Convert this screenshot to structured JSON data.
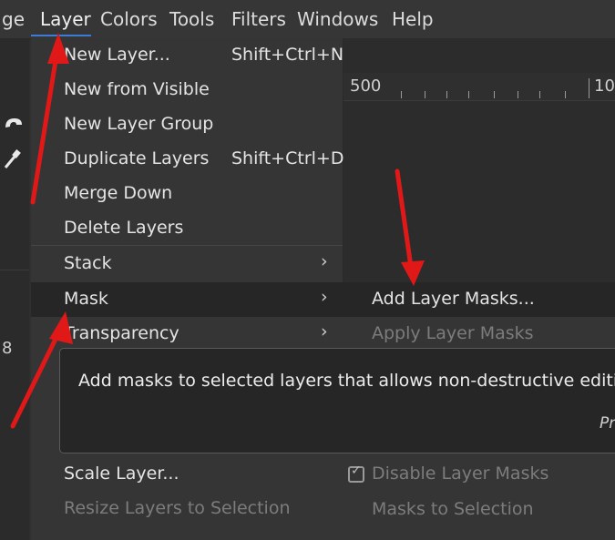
{
  "menubar": {
    "items": [
      "ge",
      "Layer",
      "Colors",
      "Tools",
      "Filters",
      "Windows",
      "Help"
    ]
  },
  "canvas": {
    "ruler_left": "500",
    "ruler_right": "10"
  },
  "left_strip": {
    "number": "8"
  },
  "layer_menu": {
    "items": [
      {
        "label": "New Layer...",
        "shortcut": "Shift+Ctrl+N"
      },
      {
        "label": "New from Visible",
        "shortcut": ""
      },
      {
        "label": "New Layer Group",
        "shortcut": ""
      },
      {
        "label": "Duplicate Layers",
        "shortcut": "Shift+Ctrl+D"
      },
      {
        "label": "Merge Down",
        "shortcut": ""
      },
      {
        "label": "Delete Layers",
        "shortcut": ""
      },
      {
        "label": "Stack",
        "shortcut": "",
        "submenu_arrow": "›"
      },
      {
        "label": "Mask",
        "shortcut": "",
        "submenu_arrow": "›"
      },
      {
        "label": "Transparency",
        "shortcut": "",
        "submenu_arrow": "›"
      },
      {
        "label": "Scale Layer...",
        "shortcut": ""
      },
      {
        "label": "Resize Layers to Selection",
        "shortcut": ""
      }
    ]
  },
  "mask_submenu": {
    "items": [
      {
        "label": "Add Layer Masks..."
      },
      {
        "label": "Apply Layer Masks"
      },
      {
        "label": "Disable Layer Masks"
      },
      {
        "label": "Masks to Selection"
      }
    ]
  },
  "tooltip": {
    "text": "Add masks to selected layers that allows non-destructive editing",
    "trailing": "Pr"
  },
  "colors": {
    "annotation_arrow": "#e01818",
    "menubar_active_underline": "#3c7bd6"
  }
}
